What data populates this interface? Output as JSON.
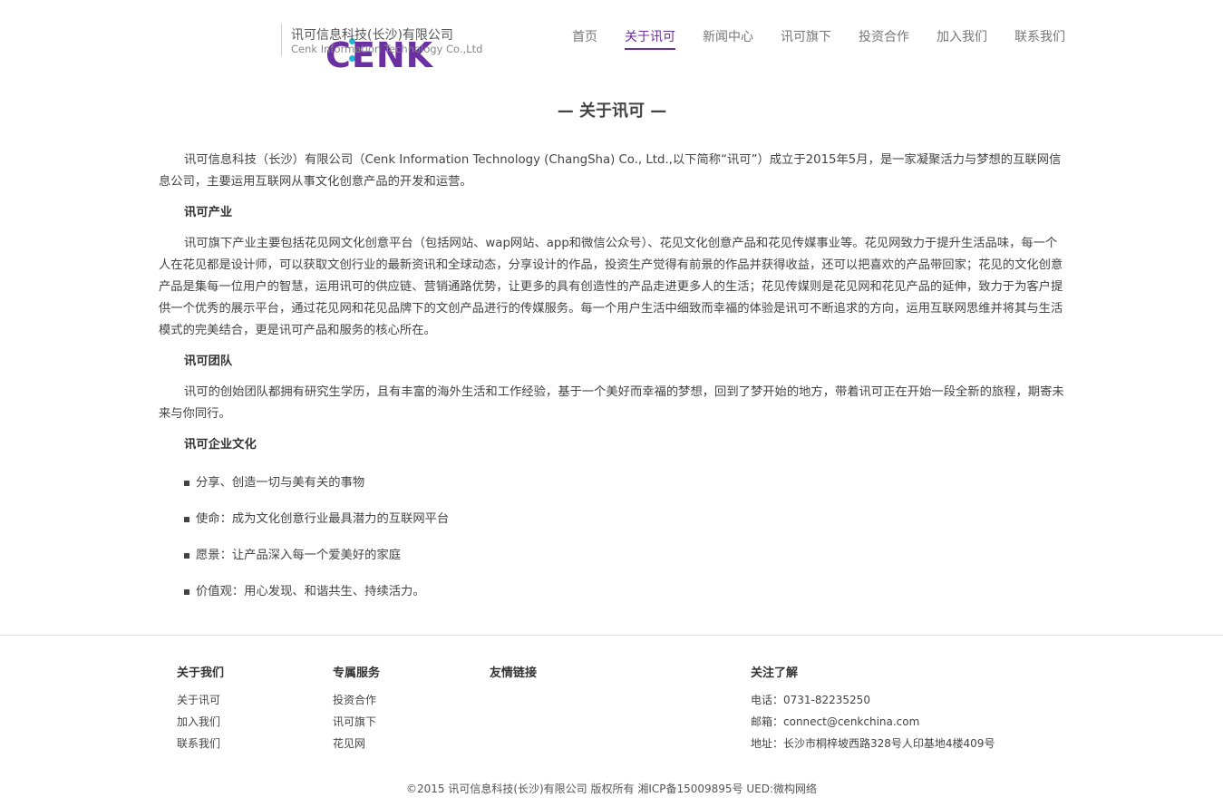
{
  "brand": {
    "logo_text": "CENK",
    "company_cn": "讯可信息科技(长沙)有限公司",
    "company_en": "Cenk Information Technology Co.,Ltd",
    "accent_color": "#6a2fa0",
    "dot_color": "#25b3d9"
  },
  "nav": {
    "items": [
      {
        "label": "首页"
      },
      {
        "label": "关于讯可"
      },
      {
        "label": "新闻中心"
      },
      {
        "label": "讯可旗下"
      },
      {
        "label": "投资合作"
      },
      {
        "label": "加入我们"
      },
      {
        "label": "联系我们"
      }
    ],
    "active": "关于讯可"
  },
  "main": {
    "title": "— 关于讯可 —",
    "intro": "讯可信息科技（长沙）有限公司（Cenk Information Technology (ChangSha) Co., Ltd.,以下简称“讯可”）成立于2015年5月，是一家凝聚活力与梦想的互联网信息公司，主要运用互联网从事文化创意产品的开发和运营。",
    "industry_heading": "讯可产业",
    "industry_text": "讯可旗下产业主要包括花见网文化创意平台（包括网站、wap网站、app和微信公众号）、花见文化创意产品和花见传媒事业等。花见网致力于提升生活品味，每一个人在花见都是设计师，可以获取文创行业的最新资讯和全球动态，分享设计的作品，投资生产觉得有前景的作品并获得收益，还可以把喜欢的产品带回家；花见的文化创意产品是集每一位用户的智慧，运用讯可的供应链、营销通路优势，让更多的具有创造性的产品走进更多人的生活；花见传媒则是花见网和花见产品的延伸，致力于为客户提供一个优秀的展示平台，通过花见网和花见品牌下的文创产品进行的传媒服务。每一个用户生活中细致而幸福的体验是讯可不断追求的方向，运用互联网思维并将其与生活模式的完美结合，更是讯可产品和服务的核心所在。",
    "team_heading": "讯可团队",
    "team_text": "讯可的创始团队都拥有研究生学历，且有丰富的海外生活和工作经验，基于一个美好而幸福的梦想，回到了梦开始的地方，带着讯可正在开始一段全新的旅程，期寄未来与你同行。",
    "culture_heading": "讯可企业文化",
    "culture_items": [
      {
        "text": "分享、创造一切与美有关的事物"
      },
      {
        "text": "使命：成为文化创意行业最具潜力的互联网平台"
      },
      {
        "text": "愿景：让产品深入每一个爱美好的家庭"
      },
      {
        "text": "价值观：用心发现、和谐共生、持续活力。"
      }
    ]
  },
  "footer": {
    "about": {
      "heading": "关于我们",
      "links": [
        {
          "label": "关于讯可"
        },
        {
          "label": "加入我们"
        },
        {
          "label": "联系我们"
        }
      ]
    },
    "services": {
      "heading": "专属服务",
      "links": [
        {
          "label": "投资合作"
        },
        {
          "label": "讯可旗下"
        },
        {
          "label": "花见网"
        }
      ]
    },
    "friends": {
      "heading": "友情链接"
    },
    "follow": {
      "heading": "关注了解",
      "phone": "电话：0731-82235250",
      "email": "邮箱：connect@cenkchina.com",
      "address": "地址：长沙市桐梓坡西路328号人印基地4楼409号"
    },
    "copyright": "©2015 讯可信息科技(长沙)有限公司 版权所有 湘ICP备15009895号 UED:微构网络"
  }
}
